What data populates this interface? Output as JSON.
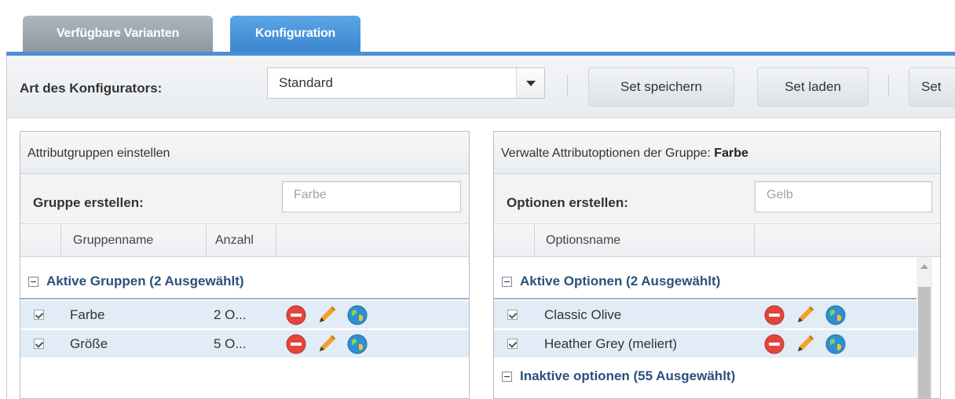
{
  "tabs": [
    {
      "label": "Verfügbare Varianten",
      "active": false
    },
    {
      "label": "Konfiguration",
      "active": true
    }
  ],
  "toolbar": {
    "configurator_label": "Art des Konfigurators:",
    "configurator_value": "Standard",
    "buttons": [
      "Set speichern",
      "Set laden",
      "Set"
    ]
  },
  "left_panel": {
    "title": "Attributgruppen einstellen",
    "create_label": "Gruppe erstellen:",
    "create_placeholder": "Farbe",
    "columns": [
      "Gruppenname",
      "Anzahl"
    ],
    "active_group_header": "Aktive Gruppen (2 Ausgewählt)",
    "rows": [
      {
        "name": "Farbe",
        "count": "2 O..."
      },
      {
        "name": "Größe",
        "count": "5 O..."
      }
    ]
  },
  "right_panel": {
    "title_prefix": "Verwalte Attributoptionen der Gruppe:",
    "title_group": "Farbe",
    "create_label": "Optionen erstellen:",
    "create_placeholder": "Gelb",
    "columns": [
      "Optionsname"
    ],
    "active_header": "Aktive Optionen (2 Ausgewählt)",
    "rows": [
      {
        "name": "Classic Olive"
      },
      {
        "name": "Heather Grey (meliert)"
      }
    ],
    "inactive_header": "Inaktive optionen (55 Ausgewählt)"
  },
  "icons": {
    "delete": "remove-icon",
    "edit": "pencil-icon",
    "translate": "globe-icon"
  },
  "colors": {
    "accent": "#4a90d6",
    "delete_red": "#e2453c",
    "edit_orange": "#f0a22a",
    "globe_blue": "#2f8fd3",
    "row_selected": "#e1ecf7"
  }
}
